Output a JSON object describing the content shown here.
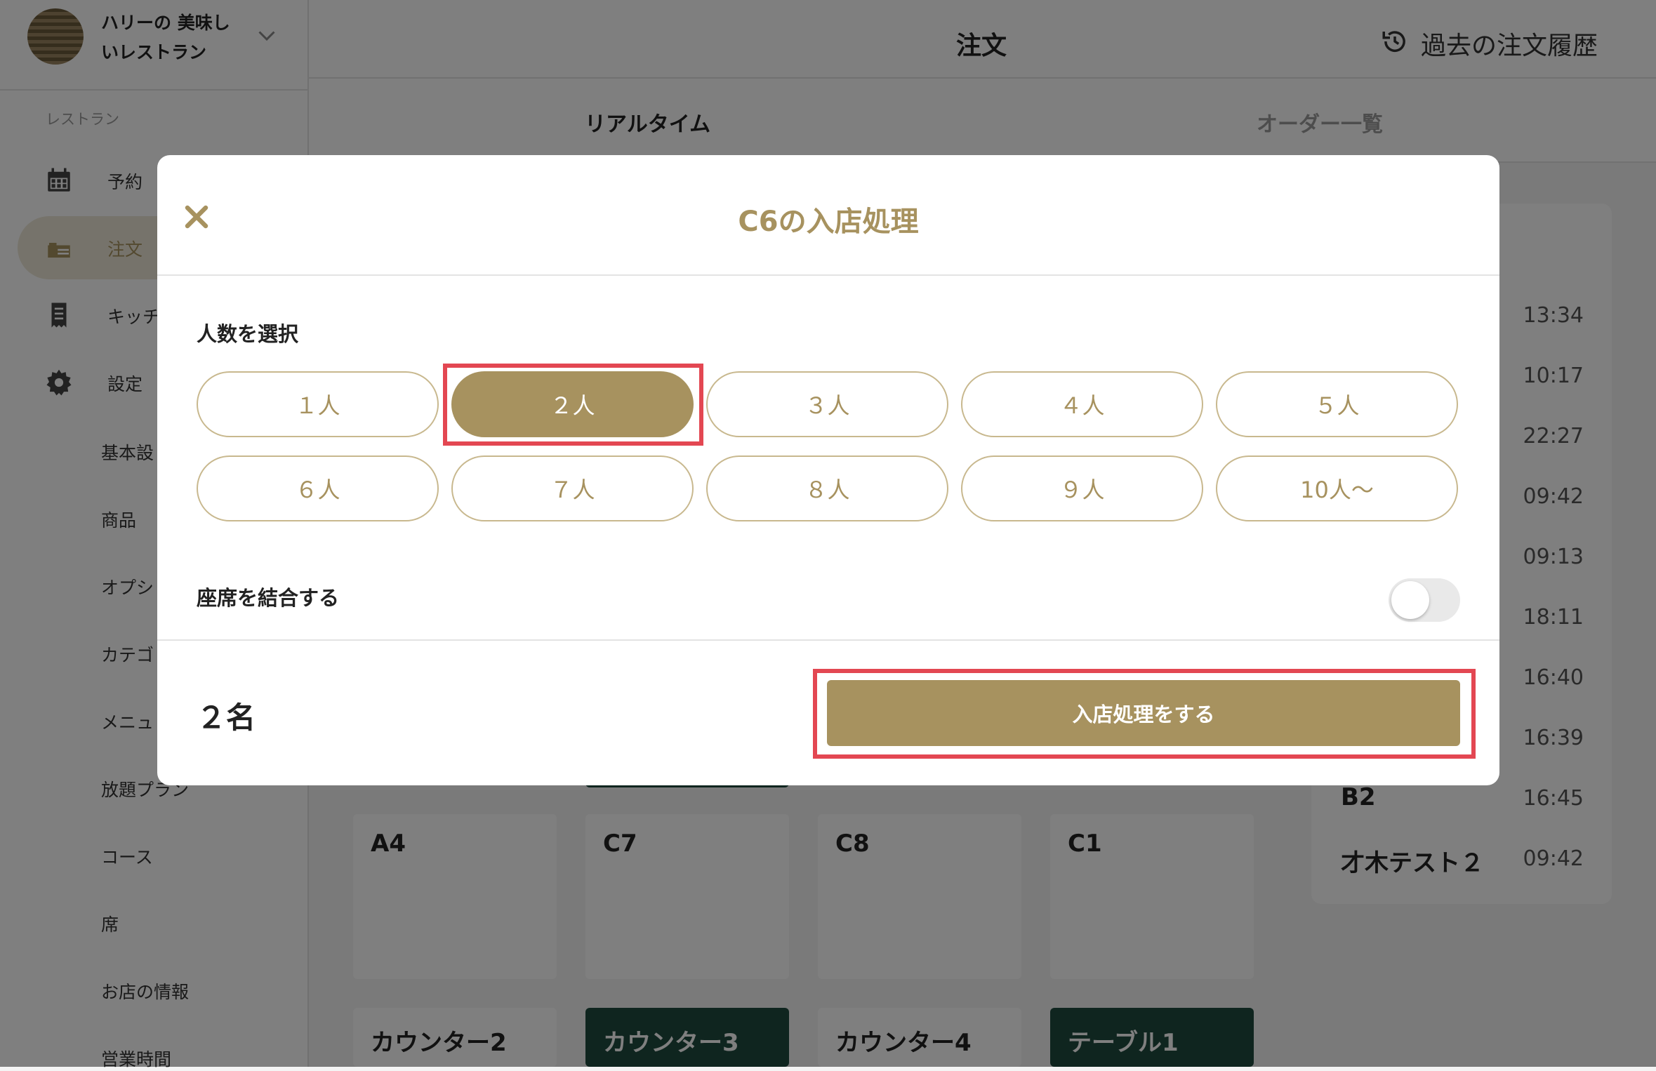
{
  "store": {
    "name": "ハリーの 美味し\nいレストラン"
  },
  "sidebar": {
    "section_label": "レストラン",
    "nav": [
      {
        "label": "予約",
        "icon": "calendar-icon"
      },
      {
        "label": "注文",
        "icon": "order-tray-icon"
      },
      {
        "label": "キッチ",
        "icon": "receipt-icon"
      },
      {
        "label": "設定",
        "icon": "gear-icon"
      }
    ],
    "sub_items": [
      "基本設",
      "商品",
      "オプシ",
      "カテゴ",
      "メニュ",
      "放題プラン",
      "コース",
      "席",
      "お店の情報",
      "営業時間"
    ]
  },
  "header": {
    "title": "注文",
    "history_label": "過去の注文履歴"
  },
  "tabs": [
    "リアルタイム",
    "オーダー一覧"
  ],
  "right_panel": {
    "rows": [
      {
        "name": "",
        "time": "13:34"
      },
      {
        "name": "",
        "time": "10:17"
      },
      {
        "name": "",
        "time": "22:27"
      },
      {
        "name": "",
        "time": "09:42"
      },
      {
        "name": "",
        "time": "09:13"
      },
      {
        "name": "",
        "time": "18:11"
      },
      {
        "name": "",
        "time": "16:40"
      },
      {
        "name": "",
        "time": "16:39"
      },
      {
        "name": "B2",
        "time": "16:45"
      },
      {
        "name": "才木テスト２",
        "time": "09:42"
      }
    ]
  },
  "tables": {
    "row1": [
      "A4",
      "C7",
      "C8",
      "C1"
    ],
    "row2": [
      "カウンター2",
      "カウンター3",
      "カウンター4",
      "テーブル1"
    ]
  },
  "modal": {
    "title": "C6の入店処理",
    "select_label": "人数を選択",
    "counts": [
      "１人",
      "２人",
      "３人",
      "４人",
      "５人",
      "６人",
      "７人",
      "８人",
      "９人",
      "10人〜"
    ],
    "selected_index": 1,
    "merge_label": "座席を結合する",
    "merge_enabled": false,
    "total": "２名",
    "submit_label": "入店処理をする"
  },
  "colors": {
    "accent": "#a7925f",
    "highlight": "#e34752",
    "table_occupied": "#1f4b3e"
  }
}
